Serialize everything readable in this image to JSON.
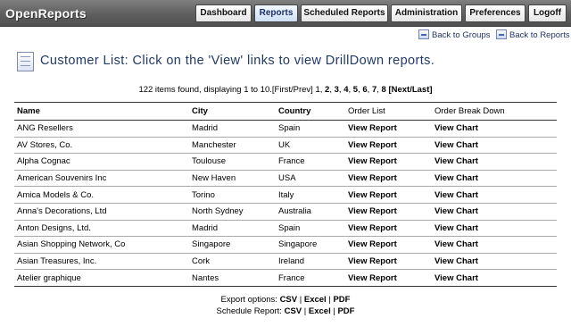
{
  "app": {
    "title": "OpenReports"
  },
  "nav": {
    "dashboard": "Dashboard",
    "reports": "Reports",
    "scheduled": "Scheduled Reports",
    "administration": "Administration",
    "preferences": "Preferences",
    "logoff": "Logoff"
  },
  "links": {
    "back_groups": "Back to Groups",
    "back_reports": "Back to Reports"
  },
  "page": {
    "title": "Customer List: Click on the 'View' links to view DrillDown reports."
  },
  "pager": {
    "summary": "122 items found, displaying 1 to 10.",
    "first_prev": "[First/Prev]",
    "current": "1",
    "pages": [
      "2",
      "3",
      "4",
      "5",
      "6",
      "7",
      "8"
    ],
    "next_last": "[Next/Last]"
  },
  "table": {
    "headers": {
      "name": "Name",
      "city": "City",
      "country": "Country",
      "order_list": "Order List",
      "order_breakdown": "Order Break Down"
    },
    "rows": [
      {
        "name": "ANG Resellers",
        "city": "Madrid",
        "country": "Spain",
        "order_list": "View Report",
        "order_breakdown": "View Chart"
      },
      {
        "name": "AV Stores, Co.",
        "city": "Manchester",
        "country": "UK",
        "order_list": "View Report",
        "order_breakdown": "View Chart"
      },
      {
        "name": "Alpha Cognac",
        "city": "Toulouse",
        "country": "France",
        "order_list": "View Report",
        "order_breakdown": "View Chart"
      },
      {
        "name": "American Souvenirs Inc",
        "city": "New Haven",
        "country": "USA",
        "order_list": "View Report",
        "order_breakdown": "View Chart"
      },
      {
        "name": "Amica Models & Co.",
        "city": "Torino",
        "country": "Italy",
        "order_list": "View Report",
        "order_breakdown": "View Chart"
      },
      {
        "name": "Anna's Decorations, Ltd",
        "city": "North Sydney",
        "country": "Australia",
        "order_list": "View Report",
        "order_breakdown": "View Chart"
      },
      {
        "name": "Anton Designs, Ltd.",
        "city": "Madrid",
        "country": "Spain",
        "order_list": "View Report",
        "order_breakdown": "View Chart"
      },
      {
        "name": "Asian Shopping Network, Co",
        "city": "Singapore",
        "country": "Singapore",
        "order_list": "View Report",
        "order_breakdown": "View Chart"
      },
      {
        "name": "Asian Treasures, Inc.",
        "city": "Cork",
        "country": "Ireland",
        "order_list": "View Report",
        "order_breakdown": "View Chart"
      },
      {
        "name": "Atelier graphique",
        "city": "Nantes",
        "country": "France",
        "order_list": "View Report",
        "order_breakdown": "View Chart"
      }
    ]
  },
  "export": {
    "label": "Export options:",
    "csv": "CSV",
    "excel": "Excel",
    "pdf": "PDF"
  },
  "schedule": {
    "label": "Schedule Report:",
    "csv": "CSV",
    "excel": "Excel",
    "pdf": "PDF"
  },
  "icons": {
    "back_groups": "back-arrow-icon",
    "back_reports": "back-arrow-icon",
    "page": "report-page-icon"
  }
}
